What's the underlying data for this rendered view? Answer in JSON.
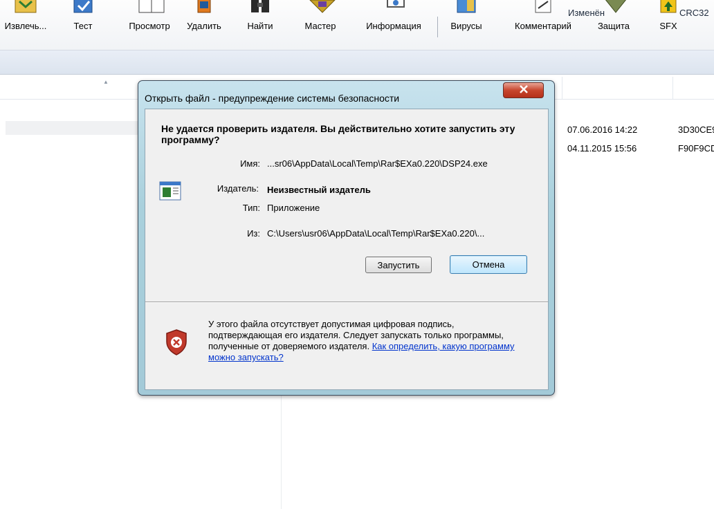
{
  "toolbar": {
    "items": [
      {
        "label": "Извлечь...",
        "icon": "extract-icon"
      },
      {
        "label": "Тест",
        "icon": "test-icon"
      },
      {
        "label": "Просмотр",
        "icon": "view-icon"
      },
      {
        "label": "Удалить",
        "icon": "delete-icon"
      },
      {
        "label": "Найти",
        "icon": "find-icon"
      },
      {
        "label": "Мастер",
        "icon": "wizard-icon"
      },
      {
        "label": "Информация",
        "icon": "info-icon"
      },
      {
        "label": "Вирусы",
        "icon": "virus-scan-icon"
      },
      {
        "label": "Комментарий",
        "icon": "comment-icon"
      },
      {
        "label": "Защита",
        "icon": "protect-icon"
      },
      {
        "label": "SFX",
        "icon": "sfx-icon"
      }
    ]
  },
  "file_list": {
    "columns": {
      "modified": "Изменён",
      "crc": "CRC32"
    },
    "rows": [
      {
        "modified": "07.06.2016 14:22",
        "crc": "3D30CE9"
      },
      {
        "modified": "04.11.2015 15:56",
        "crc": "F90F9CD"
      }
    ]
  },
  "dialog": {
    "title": "Открыть файл - предупреждение системы безопасности",
    "question": "Не удается проверить издателя.  Вы действительно хотите запустить эту программу?",
    "fields": {
      "name_label": "Имя:",
      "name_value": "...sr06\\AppData\\Local\\Temp\\Rar$EXa0.220\\DSP24.exe",
      "publisher_label": "Издатель:",
      "publisher_value": "Неизвестный издатель",
      "type_label": "Тип:",
      "type_value": "Приложение",
      "from_label": "Из:",
      "from_value": "C:\\Users\\usr06\\AppData\\Local\\Temp\\Rar$EXa0.220\\..."
    },
    "run_button": "Запустить",
    "cancel_button": "Отмена",
    "warning_text": "У этого файла отсутствует допустимая цифровая подпись, подтверждающая его издателя.  Следует запускать только программы, полученные от доверяемого издателя.",
    "warning_link": "Как определить, какую программу можно запускать?",
    "colors": {
      "close_button": "#c8462e",
      "link": "#0033cc",
      "shield": "#c0392b"
    }
  }
}
